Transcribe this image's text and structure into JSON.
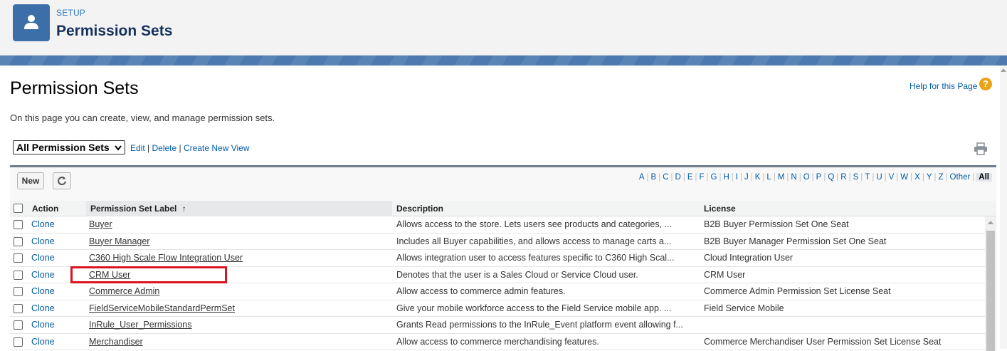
{
  "header": {
    "section_label": "SETUP",
    "title": "Permission Sets",
    "icon": "user-icon"
  },
  "page": {
    "title": "Permission Sets",
    "help_link": "Help for this Page",
    "help_icon": "?",
    "description": "On this page you can create, view, and manage permission sets."
  },
  "view": {
    "selected": "All Permission Sets",
    "edit": "Edit",
    "delete": "Delete",
    "create_new_view": "Create New View",
    "sep": "|"
  },
  "list": {
    "new_button": "New",
    "alphabet": [
      "A",
      "B",
      "C",
      "D",
      "E",
      "F",
      "G",
      "H",
      "I",
      "J",
      "K",
      "L",
      "M",
      "N",
      "O",
      "P",
      "Q",
      "R",
      "S",
      "T",
      "U",
      "V",
      "W",
      "X",
      "Y",
      "Z",
      "Other"
    ],
    "alphabet_active": "All",
    "columns": {
      "action": "Action",
      "label": "Permission Set Label",
      "sort_indicator": "↑",
      "description": "Description",
      "license": "License"
    },
    "rows": [
      {
        "action": "Clone",
        "label": "Buyer",
        "description": "Allows access to the store. Lets users see products and categories, ...",
        "license": "B2B Buyer Permission Set One Seat"
      },
      {
        "action": "Clone",
        "label": "Buyer Manager",
        "description": "Includes all Buyer capabilities, and allows access to manage carts a...",
        "license": "B2B Buyer Manager Permission Set One Seat"
      },
      {
        "action": "Clone",
        "label": "C360 High Scale Flow Integration User",
        "description": "Allows integration user to access features specific to C360 High Scal...",
        "license": "Cloud Integration User"
      },
      {
        "action": "Clone",
        "label": "CRM User",
        "description": "Denotes that the user is a Sales Cloud or Service Cloud user.",
        "license": "CRM User"
      },
      {
        "action": "Clone",
        "label": "Commerce Admin",
        "description": "Allow access to commerce admin features.",
        "license": "Commerce Admin Permission Set License Seat"
      },
      {
        "action": "Clone",
        "label": "FieldServiceMobileStandardPermSet",
        "description": "Give your mobile workforce access to the Field Service mobile app. ...",
        "license": "Field Service Mobile"
      },
      {
        "action": "Clone",
        "label": "InRule_User_Permissions",
        "description": "Grants Read permissions to the InRule_Event platform event allowing f...",
        "license": ""
      },
      {
        "action": "Clone",
        "label": "Merchandiser",
        "description": "Allow access to commerce merchandising features.",
        "license": "Commerce Merchandiser User Permission Set License Seat"
      }
    ]
  },
  "colors": {
    "link": "#015ba7",
    "highlight": "#d9141f",
    "banner": "#4b79b0",
    "icon_bg": "#3c6fa8"
  }
}
